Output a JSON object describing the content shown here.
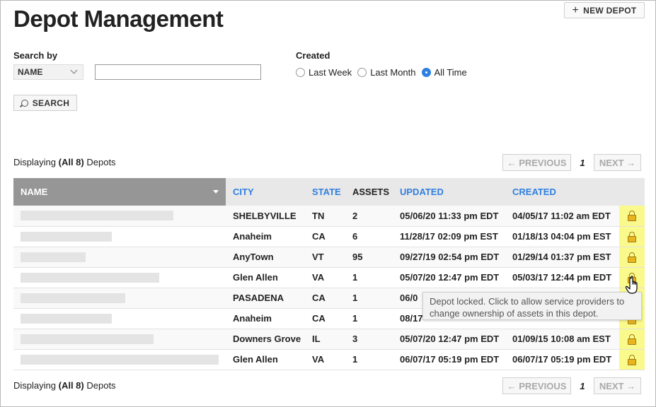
{
  "header": {
    "title": "Depot Management",
    "new_depot_label": "NEW DEPOT"
  },
  "filters": {
    "search_by_label": "Search by",
    "search_by_value": "NAME",
    "search_value": "",
    "created_label": "Created",
    "created_options": [
      {
        "label": "Last Week",
        "selected": false
      },
      {
        "label": "Last Month",
        "selected": false
      },
      {
        "label": "All Time",
        "selected": true
      }
    ],
    "search_button_label": "SEARCH"
  },
  "summary": {
    "prefix": "Displaying",
    "count": "(All 8)",
    "suffix": "Depots"
  },
  "pagination": {
    "prev_label": "← PREVIOUS",
    "page": "1",
    "next_label": "NEXT →"
  },
  "table": {
    "columns": [
      "NAME",
      "CITY",
      "STATE",
      "ASSETS",
      "UPDATED",
      "CREATED"
    ],
    "rows": [
      {
        "city": "SHELBYVILLE",
        "state": "TN",
        "assets": "2",
        "updated": "05/06/20 11:33 pm EDT",
        "created": "04/05/17 11:02 am EDT",
        "redact_fraction": 0.77
      },
      {
        "city": "Anaheim",
        "state": "CA",
        "assets": "6",
        "updated": "11/28/17 02:09 pm EST",
        "created": "01/18/13 04:04 pm EST",
        "redact_fraction": 0.46
      },
      {
        "city": "AnyTown",
        "state": "VT",
        "assets": "95",
        "updated": "09/27/19 02:54 pm EDT",
        "created": "01/29/14 01:37 pm EST",
        "redact_fraction": 0.33
      },
      {
        "city": "Glen Allen",
        "state": "VA",
        "assets": "1",
        "updated": "05/07/20 12:47 pm EDT",
        "created": "05/03/17 12:44 pm EDT",
        "redact_fraction": 0.7
      },
      {
        "city": "PASADENA",
        "state": "CA",
        "assets": "1",
        "updated": "06/0",
        "created": "",
        "redact_fraction": 0.53
      },
      {
        "city": "Anaheim",
        "state": "CA",
        "assets": "1",
        "updated": "08/17",
        "created": "",
        "redact_fraction": 0.46
      },
      {
        "city": "Downers Grove",
        "state": "IL",
        "assets": "3",
        "updated": "05/07/20 12:47 pm EDT",
        "created": "01/09/15 10:08 am EST",
        "redact_fraction": 0.67
      },
      {
        "city": "Glen Allen",
        "state": "VA",
        "assets": "1",
        "updated": "06/07/17 05:19 pm EDT",
        "created": "06/07/17 05:19 pm EDT",
        "redact_fraction": 1.0
      }
    ]
  },
  "tooltip": {
    "text": "Depot locked. Click to allow service providers to change ownership of assets in this depot."
  },
  "colors": {
    "accent": "#2f7fe0",
    "lock_highlight": "#f9f98c",
    "lock": "#e8b51f"
  }
}
